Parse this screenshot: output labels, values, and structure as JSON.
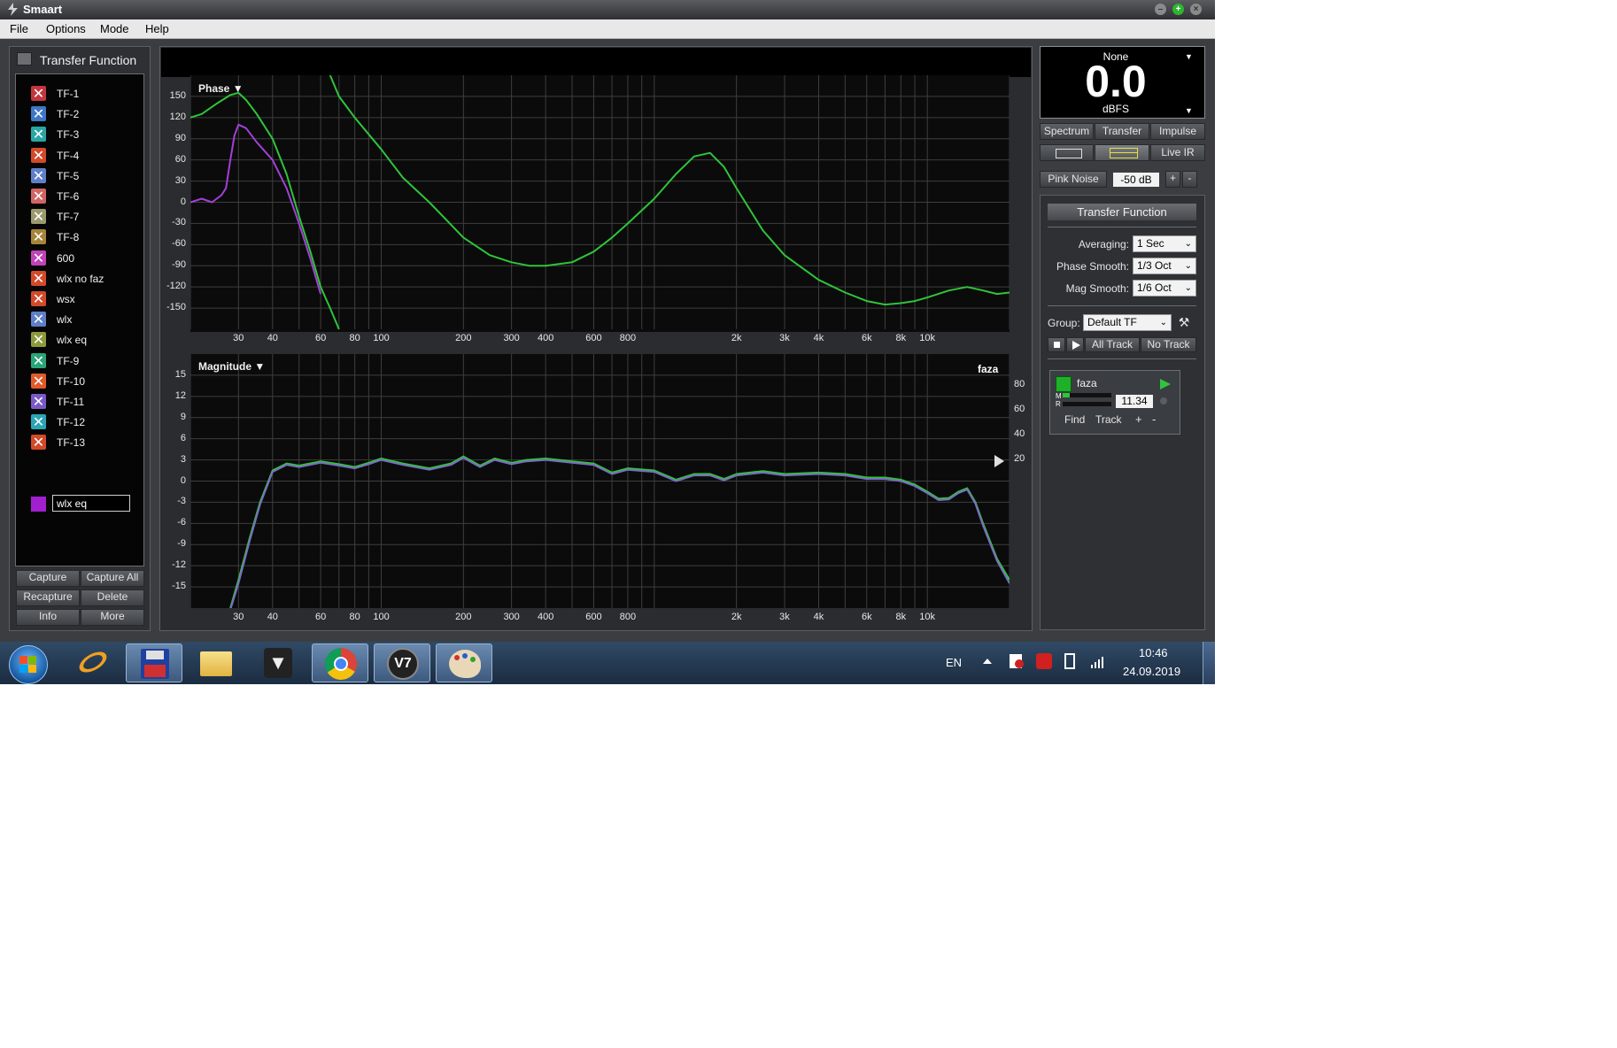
{
  "window": {
    "title": "Smaart",
    "min_icon": "minimize-icon",
    "max_icon": "maximize-icon",
    "close_icon": "close-icon"
  },
  "menu": [
    "File",
    "Options",
    "Mode",
    "Help"
  ],
  "left_panel": {
    "header": "Transfer Function",
    "items": [
      {
        "label": "TF-1",
        "color": "#c2363f"
      },
      {
        "label": "TF-2",
        "color": "#3e77c4"
      },
      {
        "label": "TF-3",
        "color": "#2aa5a5"
      },
      {
        "label": "TF-4",
        "color": "#d24a2a"
      },
      {
        "label": "TF-5",
        "color": "#5f7fc8"
      },
      {
        "label": "TF-6",
        "color": "#d06565"
      },
      {
        "label": "TF-7",
        "color": "#9a9a6e"
      },
      {
        "label": "TF-8",
        "color": "#a6853a"
      },
      {
        "label": "600",
        "color": "#c043b8"
      },
      {
        "label": "wlx no faz",
        "color": "#d24a2a"
      },
      {
        "label": "wsx",
        "color": "#d24a2a"
      },
      {
        "label": "wlx",
        "color": "#5f7fc8"
      },
      {
        "label": "wlx eq",
        "color": "#8d9a3c"
      },
      {
        "label": "TF-9",
        "color": "#2aa57a"
      },
      {
        "label": "TF-10",
        "color": "#e05a2a"
      },
      {
        "label": "TF-11",
        "color": "#7a5ac8"
      },
      {
        "label": "TF-12",
        "color": "#2aa5b5"
      },
      {
        "label": "TF-13",
        "color": "#d24a2a"
      }
    ],
    "editing": {
      "value": "wlx eq",
      "color": "#a020d0"
    },
    "buttons": [
      [
        "Capture",
        "Capture All"
      ],
      [
        "Recapture",
        "Delete"
      ],
      [
        "Info",
        "More"
      ]
    ]
  },
  "phase_plot": {
    "label": "Phase",
    "y_ticks": [
      "150",
      "120",
      "90",
      "60",
      "30",
      "0",
      "-30",
      "-60",
      "-90",
      "-120",
      "-150"
    ],
    "x_ticks": [
      "30",
      "40",
      "60",
      "80",
      "100",
      "200",
      "300",
      "400",
      "600",
      "800",
      "2k",
      "3k",
      "4k",
      "6k",
      "8k",
      "10k"
    ]
  },
  "magnitude_plot": {
    "label": "Magnitude",
    "trace_name": "faza",
    "y_ticks": [
      "15",
      "12",
      "9",
      "6",
      "3",
      "0",
      "-3",
      "-6",
      "-9",
      "-12",
      "-15"
    ],
    "right_ticks": [
      "80",
      "60",
      "40",
      "20"
    ],
    "x_ticks": [
      "30",
      "40",
      "60",
      "80",
      "100",
      "200",
      "300",
      "400",
      "600",
      "800",
      "2k",
      "3k",
      "4k",
      "6k",
      "8k",
      "10k"
    ]
  },
  "meter": {
    "source": "None",
    "value": "0.0",
    "unit": "dBFS"
  },
  "view_tabs": [
    "Spectrum",
    "Transfer",
    "Impulse"
  ],
  "live_ir": "Live IR",
  "generator": {
    "label": "Pink Noise",
    "level": "-50 dB",
    "plus": "+",
    "minus": "-"
  },
  "tf_settings": {
    "title": "Transfer Function",
    "averaging_label": "Averaging:",
    "averaging": "1 Sec",
    "phase_smooth_label": "Phase Smooth:",
    "phase_smooth": "1/3 Oct",
    "mag_smooth_label": "Mag Smooth:",
    "mag_smooth": "1/6 Oct",
    "group_label": "Group:",
    "group": "Default TF",
    "all_track": "All Track",
    "no_track": "No Track"
  },
  "measurement": {
    "name": "faza",
    "m": "M",
    "r": "R",
    "delay": "11.34",
    "find": "Find",
    "track": "Track",
    "plus": "+",
    "minus": "-",
    "color": "#1fb02a"
  },
  "chart_data": [
    {
      "type": "line",
      "title": "Phase",
      "xlabel": "",
      "ylabel": "",
      "x_scale": "log",
      "xlim": [
        20,
        20000
      ],
      "ylim": [
        -180,
        180
      ],
      "grid": true,
      "series": [
        {
          "color": "#2fc43a",
          "x": [
            20,
            22,
            25,
            28,
            30,
            32,
            35,
            40,
            45,
            50,
            55,
            60,
            65,
            70
          ],
          "y": [
            120,
            125,
            140,
            152,
            155,
            145,
            125,
            90,
            40,
            -20,
            -70,
            -120,
            -150,
            -180
          ]
        },
        {
          "color": "#2fc43a",
          "x": [
            65,
            70,
            80,
            100,
            120,
            150,
            200,
            250,
            300,
            350,
            400,
            500,
            600,
            700,
            800,
            1000,
            1200,
            1400,
            1600,
            1800,
            2000,
            2500,
            3000,
            4000,
            5000,
            6000,
            7000,
            8000,
            9000,
            10000,
            12000,
            14000,
            16000,
            18000,
            20000
          ],
          "y": [
            180,
            150,
            120,
            75,
            35,
            0,
            -50,
            -75,
            -85,
            -90,
            -90,
            -85,
            -70,
            -50,
            -30,
            5,
            40,
            65,
            70,
            50,
            20,
            -40,
            -75,
            -110,
            -128,
            -140,
            -145,
            -143,
            -140,
            -135,
            -125,
            -120,
            -125,
            -130,
            -128
          ]
        },
        {
          "color": "#a340d8",
          "x": [
            20,
            22,
            24,
            26,
            27,
            28,
            29,
            30,
            32,
            35,
            40,
            45,
            50,
            55,
            60
          ],
          "y": [
            0,
            5,
            0,
            10,
            20,
            60,
            95,
            110,
            105,
            85,
            60,
            20,
            -30,
            -80,
            -130
          ]
        }
      ]
    },
    {
      "type": "line",
      "title": "Magnitude",
      "xlabel": "",
      "ylabel": "",
      "x_scale": "log",
      "xlim": [
        20,
        20000
      ],
      "ylim": [
        -18,
        18
      ],
      "grid": true,
      "series": [
        {
          "name": "faza",
          "color": "#2fc43a",
          "x": [
            28,
            30,
            33,
            36,
            40,
            45,
            50,
            60,
            70,
            80,
            90,
            100,
            120,
            150,
            180,
            200,
            230,
            260,
            300,
            340,
            400,
            500,
            600,
            700,
            800,
            1000,
            1200,
            1400,
            1600,
            1800,
            2000,
            2500,
            3000,
            4000,
            5000,
            6000,
            7000,
            8000,
            9000,
            10000,
            11000,
            12000,
            13000,
            14000,
            15000,
            16000,
            18000,
            20000
          ],
          "y": [
            -18,
            -14,
            -8,
            -3,
            1.5,
            2.5,
            2.2,
            2.8,
            2.4,
            2,
            2.6,
            3.2,
            2.5,
            1.8,
            2.5,
            3.5,
            2.2,
            3.2,
            2.6,
            3,
            3.2,
            2.8,
            2.5,
            1.2,
            1.8,
            1.5,
            0.2,
            1,
            1,
            0.3,
            1,
            1.4,
            1,
            1.2,
            1,
            0.5,
            0.5,
            0.2,
            -0.5,
            -1.5,
            -2.5,
            -2.4,
            -1.5,
            -1,
            -3,
            -6,
            -11,
            -14
          ]
        },
        {
          "color": "#7a6cc4",
          "x": [
            28,
            30,
            33,
            36,
            40,
            45,
            50,
            60,
            70,
            80,
            90,
            100,
            120,
            150,
            180,
            200,
            230,
            260,
            300,
            340,
            400,
            500,
            600,
            700,
            800,
            1000,
            1200,
            1400,
            1600,
            1800,
            2000,
            2500,
            3000,
            4000,
            5000,
            6000,
            7000,
            8000,
            9000,
            10000,
            11000,
            12000,
            13000,
            14000,
            15000,
            16000,
            18000,
            20000
          ],
          "y": [
            -18.5,
            -14.5,
            -8.4,
            -3.3,
            1.3,
            2.3,
            2.0,
            2.6,
            2.2,
            1.8,
            2.4,
            3.0,
            2.3,
            1.6,
            2.3,
            3.3,
            2.0,
            3.0,
            2.4,
            2.8,
            3.0,
            2.6,
            2.3,
            1.0,
            1.6,
            1.3,
            0,
            0.8,
            0.8,
            0.1,
            0.8,
            1.2,
            0.8,
            1.0,
            0.8,
            0.3,
            0.3,
            0,
            -0.7,
            -1.7,
            -2.7,
            -2.6,
            -1.7,
            -1.2,
            -3.2,
            -6.3,
            -11.3,
            -14.5
          ]
        }
      ]
    }
  ]
}
